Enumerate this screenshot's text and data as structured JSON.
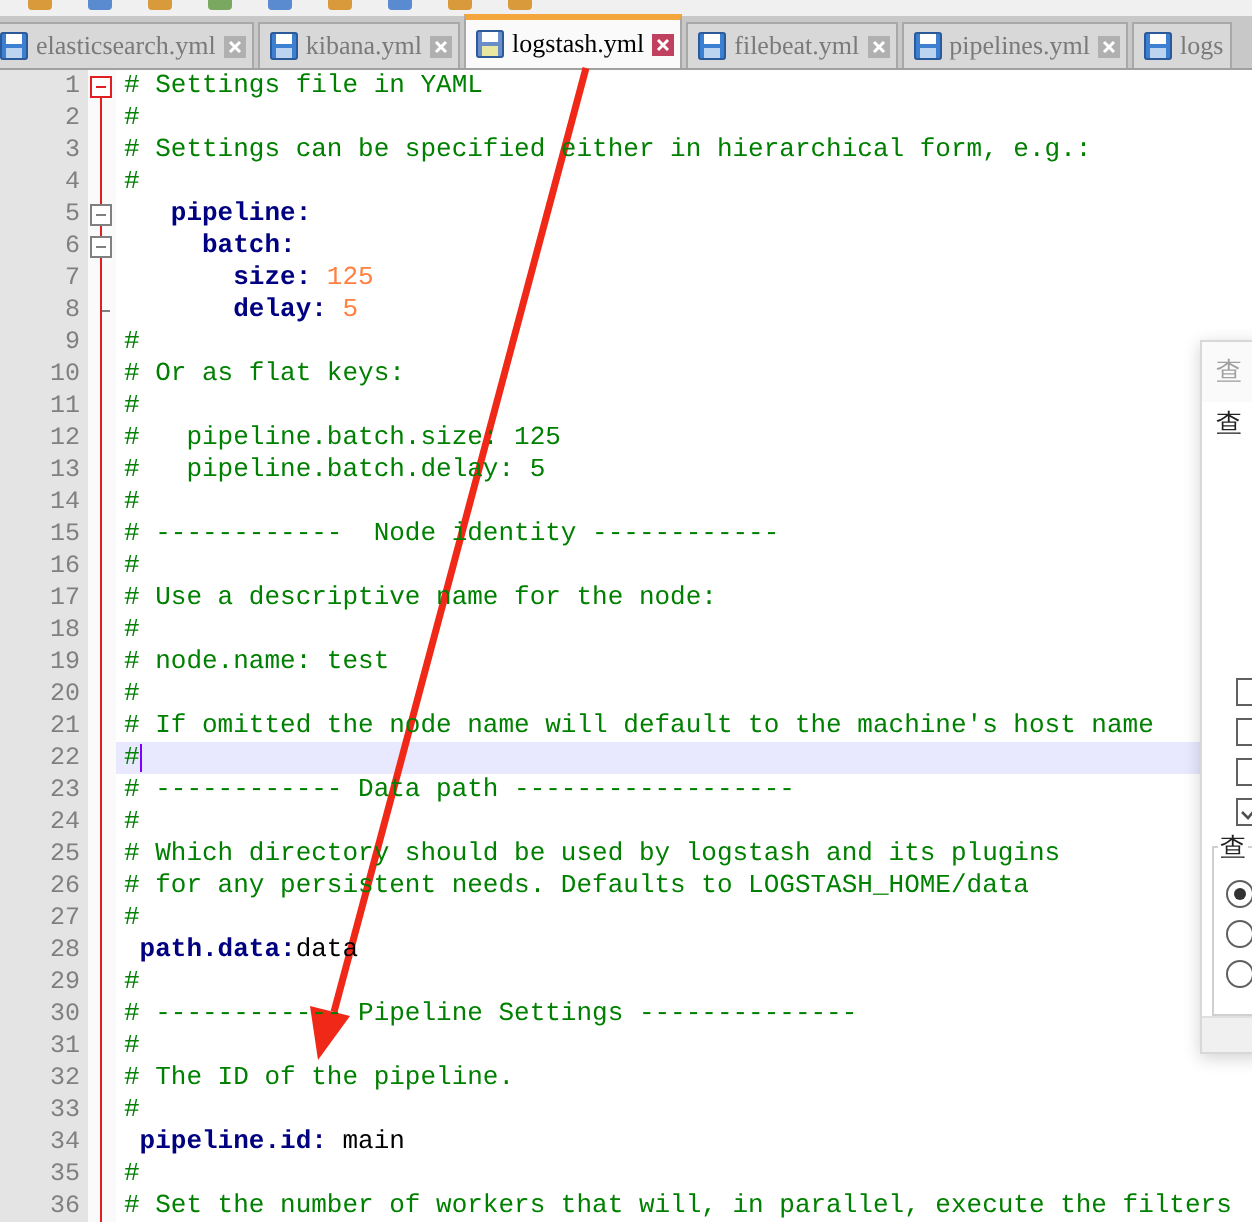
{
  "tabs": [
    {
      "label": "elasticsearch.yml",
      "selected": false
    },
    {
      "label": "kibana.yml",
      "selected": false
    },
    {
      "label": "logstash.yml",
      "selected": true
    },
    {
      "label": "filebeat.yml",
      "selected": false
    },
    {
      "label": "pipelines.yml",
      "selected": false
    },
    {
      "label": "logs",
      "selected": false
    }
  ],
  "lines": [
    {
      "number": "1",
      "expanded": true,
      "highlighted": true,
      "current": false,
      "tokens": [
        {
          "kind": "comment",
          "text": "# Settings file in YAML"
        }
      ]
    },
    {
      "number": "2",
      "current": false,
      "tokens": [
        {
          "kind": "comment",
          "text": "#"
        }
      ]
    },
    {
      "number": "3",
      "current": false,
      "tokens": [
        {
          "kind": "comment",
          "text": "# Settings can be specified either in hierarchical form, e.g.:"
        }
      ]
    },
    {
      "number": "4",
      "current": false,
      "tokens": [
        {
          "kind": "comment",
          "text": "#"
        }
      ]
    },
    {
      "number": "5",
      "expanded": true,
      "highlighted": false,
      "current": false,
      "tokens": [
        {
          "kind": "key",
          "text": "   pipeline:"
        }
      ]
    },
    {
      "number": "6",
      "expanded": true,
      "highlighted": false,
      "current": false,
      "tokens": [
        {
          "kind": "key",
          "text": "     batch:"
        }
      ]
    },
    {
      "number": "7",
      "current": false,
      "tokens": [
        {
          "kind": "key",
          "text": "       size: "
        },
        {
          "kind": "number",
          "text": "125"
        }
      ]
    },
    {
      "number": "8",
      "fold_end": true,
      "current": false,
      "tokens": [
        {
          "kind": "key",
          "text": "       delay: "
        },
        {
          "kind": "number",
          "text": "5"
        }
      ]
    },
    {
      "number": "9",
      "current": false,
      "tokens": [
        {
          "kind": "comment",
          "text": "#"
        }
      ]
    },
    {
      "number": "10",
      "current": false,
      "tokens": [
        {
          "kind": "comment",
          "text": "# Or as flat keys:"
        }
      ]
    },
    {
      "number": "11",
      "current": false,
      "tokens": [
        {
          "kind": "comment",
          "text": "#"
        }
      ]
    },
    {
      "number": "12",
      "current": false,
      "tokens": [
        {
          "kind": "comment",
          "text": "#   pipeline.batch.size: 125"
        }
      ]
    },
    {
      "number": "13",
      "current": false,
      "tokens": [
        {
          "kind": "comment",
          "text": "#   pipeline.batch.delay: 5"
        }
      ]
    },
    {
      "number": "14",
      "current": false,
      "tokens": [
        {
          "kind": "comment",
          "text": "#"
        }
      ]
    },
    {
      "number": "15",
      "current": false,
      "tokens": [
        {
          "kind": "comment",
          "text": "# ------------  Node identity ------------"
        }
      ]
    },
    {
      "number": "16",
      "current": false,
      "tokens": [
        {
          "kind": "comment",
          "text": "#"
        }
      ]
    },
    {
      "number": "17",
      "current": false,
      "tokens": [
        {
          "kind": "comment",
          "text": "# Use a descriptive name for the node:"
        }
      ]
    },
    {
      "number": "18",
      "current": false,
      "tokens": [
        {
          "kind": "comment",
          "text": "#"
        }
      ]
    },
    {
      "number": "19",
      "current": false,
      "tokens": [
        {
          "kind": "comment",
          "text": "# node.name: test"
        }
      ]
    },
    {
      "number": "20",
      "current": false,
      "tokens": [
        {
          "kind": "comment",
          "text": "#"
        }
      ]
    },
    {
      "number": "21",
      "current": false,
      "tokens": [
        {
          "kind": "comment",
          "text": "# If omitted the node name will default to the machine's host name"
        }
      ]
    },
    {
      "number": "22",
      "current": true,
      "tokens": [
        {
          "kind": "comment",
          "text": "#"
        }
      ]
    },
    {
      "number": "23",
      "current": false,
      "tokens": [
        {
          "kind": "comment",
          "text": "# ------------ Data path ------------------"
        }
      ]
    },
    {
      "number": "24",
      "current": false,
      "tokens": [
        {
          "kind": "comment",
          "text": "#"
        }
      ]
    },
    {
      "number": "25",
      "current": false,
      "tokens": [
        {
          "kind": "comment",
          "text": "# Which directory should be used by logstash and its plugins"
        }
      ]
    },
    {
      "number": "26",
      "current": false,
      "tokens": [
        {
          "kind": "comment",
          "text": "# for any persistent needs. Defaults to LOGSTASH_HOME/data"
        }
      ]
    },
    {
      "number": "27",
      "current": false,
      "tokens": [
        {
          "kind": "comment",
          "text": "#"
        }
      ]
    },
    {
      "number": "28",
      "current": false,
      "tokens": [
        {
          "kind": "key",
          "text": " path.data:"
        },
        {
          "kind": "plain",
          "text": "data"
        }
      ]
    },
    {
      "number": "29",
      "current": false,
      "tokens": [
        {
          "kind": "comment",
          "text": "#"
        }
      ]
    },
    {
      "number": "30",
      "current": false,
      "tokens": [
        {
          "kind": "comment",
          "text": "# ------------ Pipeline Settings --------------"
        }
      ]
    },
    {
      "number": "31",
      "current": false,
      "tokens": [
        {
          "kind": "comment",
          "text": "#"
        }
      ]
    },
    {
      "number": "32",
      "current": false,
      "tokens": [
        {
          "kind": "comment",
          "text": "# The ID of the pipeline."
        }
      ]
    },
    {
      "number": "33",
      "current": false,
      "tokens": [
        {
          "kind": "comment",
          "text": "#"
        }
      ]
    },
    {
      "number": "34",
      "current": false,
      "tokens": [
        {
          "kind": "key",
          "text": " pipeline.id:"
        },
        {
          "kind": "plain",
          "text": " main"
        }
      ]
    },
    {
      "number": "35",
      "current": false,
      "tokens": [
        {
          "kind": "comment",
          "text": "#"
        }
      ]
    },
    {
      "number": "36",
      "current": false,
      "tokens": [
        {
          "kind": "comment",
          "text": "# Set the number of workers that will, in parallel, execute the filters"
        }
      ]
    }
  ],
  "dialog": {
    "title": "查",
    "label": "查",
    "checkboxes": [
      {
        "checked": false
      },
      {
        "checked": false
      },
      {
        "checked": false
      },
      {
        "checked": true
      }
    ],
    "group_label": "查",
    "radios": [
      {
        "selected": true
      },
      {
        "selected": false
      },
      {
        "selected": false
      }
    ]
  }
}
